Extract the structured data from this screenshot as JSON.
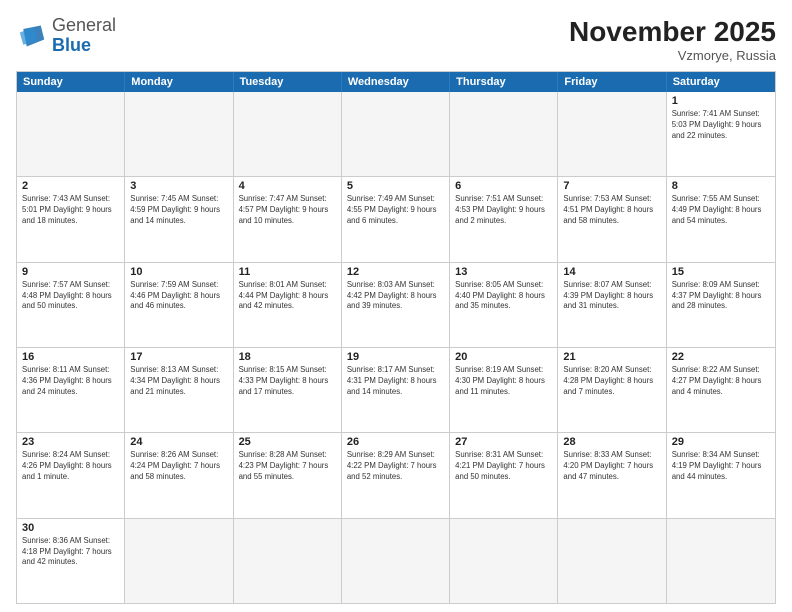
{
  "logo": {
    "general": "General",
    "blue": "Blue"
  },
  "title": "November 2025",
  "subtitle": "Vzmorye, Russia",
  "header_days": [
    "Sunday",
    "Monday",
    "Tuesday",
    "Wednesday",
    "Thursday",
    "Friday",
    "Saturday"
  ],
  "weeks": [
    [
      {
        "day": "",
        "info": "",
        "empty": true
      },
      {
        "day": "",
        "info": "",
        "empty": true
      },
      {
        "day": "",
        "info": "",
        "empty": true
      },
      {
        "day": "",
        "info": "",
        "empty": true
      },
      {
        "day": "",
        "info": "",
        "empty": true
      },
      {
        "day": "",
        "info": "",
        "empty": true
      },
      {
        "day": "1",
        "info": "Sunrise: 7:41 AM\nSunset: 5:03 PM\nDaylight: 9 hours\nand 22 minutes.",
        "empty": false
      }
    ],
    [
      {
        "day": "2",
        "info": "Sunrise: 7:43 AM\nSunset: 5:01 PM\nDaylight: 9 hours\nand 18 minutes.",
        "empty": false
      },
      {
        "day": "3",
        "info": "Sunrise: 7:45 AM\nSunset: 4:59 PM\nDaylight: 9 hours\nand 14 minutes.",
        "empty": false
      },
      {
        "day": "4",
        "info": "Sunrise: 7:47 AM\nSunset: 4:57 PM\nDaylight: 9 hours\nand 10 minutes.",
        "empty": false
      },
      {
        "day": "5",
        "info": "Sunrise: 7:49 AM\nSunset: 4:55 PM\nDaylight: 9 hours\nand 6 minutes.",
        "empty": false
      },
      {
        "day": "6",
        "info": "Sunrise: 7:51 AM\nSunset: 4:53 PM\nDaylight: 9 hours\nand 2 minutes.",
        "empty": false
      },
      {
        "day": "7",
        "info": "Sunrise: 7:53 AM\nSunset: 4:51 PM\nDaylight: 8 hours\nand 58 minutes.",
        "empty": false
      },
      {
        "day": "8",
        "info": "Sunrise: 7:55 AM\nSunset: 4:49 PM\nDaylight: 8 hours\nand 54 minutes.",
        "empty": false
      }
    ],
    [
      {
        "day": "9",
        "info": "Sunrise: 7:57 AM\nSunset: 4:48 PM\nDaylight: 8 hours\nand 50 minutes.",
        "empty": false
      },
      {
        "day": "10",
        "info": "Sunrise: 7:59 AM\nSunset: 4:46 PM\nDaylight: 8 hours\nand 46 minutes.",
        "empty": false
      },
      {
        "day": "11",
        "info": "Sunrise: 8:01 AM\nSunset: 4:44 PM\nDaylight: 8 hours\nand 42 minutes.",
        "empty": false
      },
      {
        "day": "12",
        "info": "Sunrise: 8:03 AM\nSunset: 4:42 PM\nDaylight: 8 hours\nand 39 minutes.",
        "empty": false
      },
      {
        "day": "13",
        "info": "Sunrise: 8:05 AM\nSunset: 4:40 PM\nDaylight: 8 hours\nand 35 minutes.",
        "empty": false
      },
      {
        "day": "14",
        "info": "Sunrise: 8:07 AM\nSunset: 4:39 PM\nDaylight: 8 hours\nand 31 minutes.",
        "empty": false
      },
      {
        "day": "15",
        "info": "Sunrise: 8:09 AM\nSunset: 4:37 PM\nDaylight: 8 hours\nand 28 minutes.",
        "empty": false
      }
    ],
    [
      {
        "day": "16",
        "info": "Sunrise: 8:11 AM\nSunset: 4:36 PM\nDaylight: 8 hours\nand 24 minutes.",
        "empty": false
      },
      {
        "day": "17",
        "info": "Sunrise: 8:13 AM\nSunset: 4:34 PM\nDaylight: 8 hours\nand 21 minutes.",
        "empty": false
      },
      {
        "day": "18",
        "info": "Sunrise: 8:15 AM\nSunset: 4:33 PM\nDaylight: 8 hours\nand 17 minutes.",
        "empty": false
      },
      {
        "day": "19",
        "info": "Sunrise: 8:17 AM\nSunset: 4:31 PM\nDaylight: 8 hours\nand 14 minutes.",
        "empty": false
      },
      {
        "day": "20",
        "info": "Sunrise: 8:19 AM\nSunset: 4:30 PM\nDaylight: 8 hours\nand 11 minutes.",
        "empty": false
      },
      {
        "day": "21",
        "info": "Sunrise: 8:20 AM\nSunset: 4:28 PM\nDaylight: 8 hours\nand 7 minutes.",
        "empty": false
      },
      {
        "day": "22",
        "info": "Sunrise: 8:22 AM\nSunset: 4:27 PM\nDaylight: 8 hours\nand 4 minutes.",
        "empty": false
      }
    ],
    [
      {
        "day": "23",
        "info": "Sunrise: 8:24 AM\nSunset: 4:26 PM\nDaylight: 8 hours\nand 1 minute.",
        "empty": false
      },
      {
        "day": "24",
        "info": "Sunrise: 8:26 AM\nSunset: 4:24 PM\nDaylight: 7 hours\nand 58 minutes.",
        "empty": false
      },
      {
        "day": "25",
        "info": "Sunrise: 8:28 AM\nSunset: 4:23 PM\nDaylight: 7 hours\nand 55 minutes.",
        "empty": false
      },
      {
        "day": "26",
        "info": "Sunrise: 8:29 AM\nSunset: 4:22 PM\nDaylight: 7 hours\nand 52 minutes.",
        "empty": false
      },
      {
        "day": "27",
        "info": "Sunrise: 8:31 AM\nSunset: 4:21 PM\nDaylight: 7 hours\nand 50 minutes.",
        "empty": false
      },
      {
        "day": "28",
        "info": "Sunrise: 8:33 AM\nSunset: 4:20 PM\nDaylight: 7 hours\nand 47 minutes.",
        "empty": false
      },
      {
        "day": "29",
        "info": "Sunrise: 8:34 AM\nSunset: 4:19 PM\nDaylight: 7 hours\nand 44 minutes.",
        "empty": false
      }
    ],
    [
      {
        "day": "30",
        "info": "Sunrise: 8:36 AM\nSunset: 4:18 PM\nDaylight: 7 hours\nand 42 minutes.",
        "empty": false
      },
      {
        "day": "",
        "info": "",
        "empty": true
      },
      {
        "day": "",
        "info": "",
        "empty": true
      },
      {
        "day": "",
        "info": "",
        "empty": true
      },
      {
        "day": "",
        "info": "",
        "empty": true
      },
      {
        "day": "",
        "info": "",
        "empty": true
      },
      {
        "day": "",
        "info": "",
        "empty": true
      }
    ]
  ]
}
